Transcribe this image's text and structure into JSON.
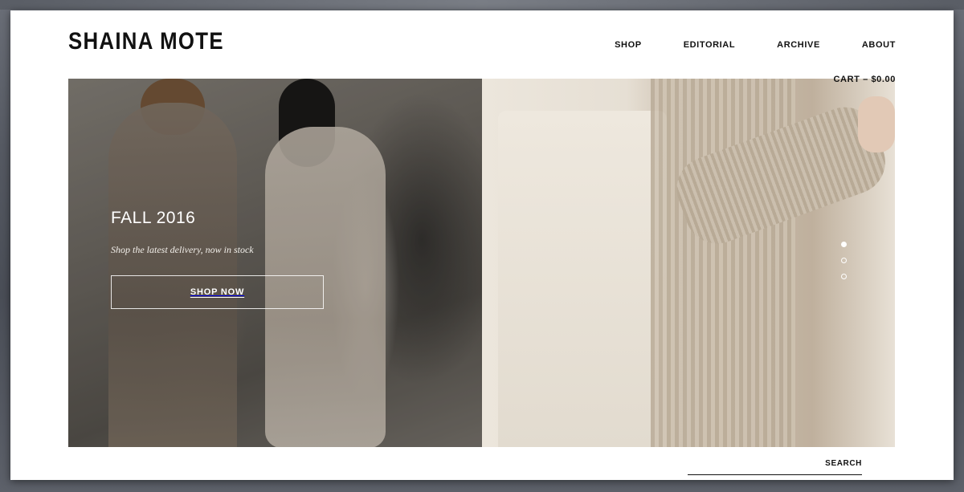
{
  "brand": {
    "logo": "SHAINA MOTE"
  },
  "nav": {
    "items": [
      "SHOP",
      "EDITORIAL",
      "ARCHIVE",
      "ABOUT"
    ]
  },
  "cart": {
    "label": "CART – $0.00"
  },
  "hero": {
    "title": "FALL 2016",
    "subtitle": "Shop the latest delivery, now in stock",
    "cta_label": "SHOP NOW",
    "slides_total": 3,
    "active_slide": 1
  },
  "search": {
    "label": "SEARCH",
    "value": "",
    "placeholder": ""
  }
}
